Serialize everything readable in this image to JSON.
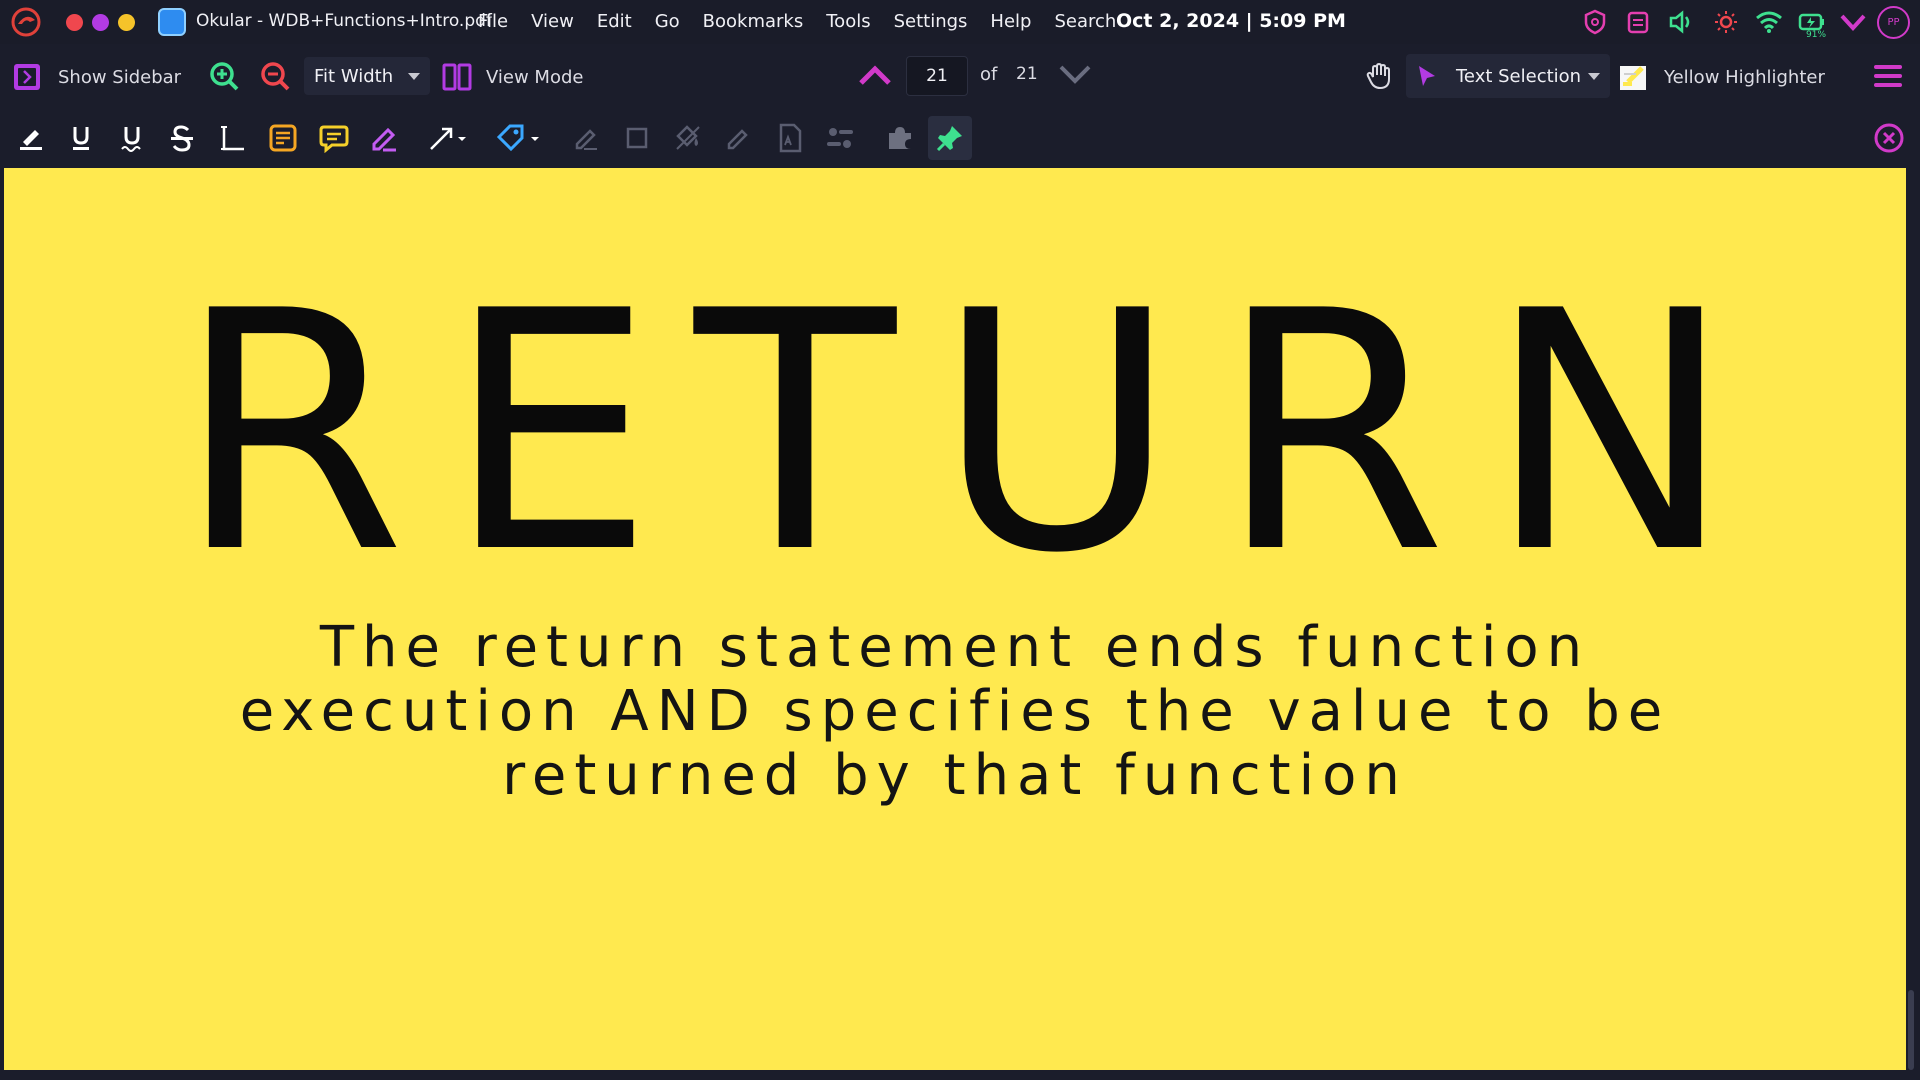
{
  "window": {
    "title": "Okular - WDB+Functions+Intro.pdf",
    "clock": "Oct 2, 2024 | 5:09 PM",
    "battery_percent": "91%",
    "avatar_initials": "PP"
  },
  "menu": {
    "items": [
      "File",
      "View",
      "Edit",
      "Go",
      "Bookmarks",
      "Tools",
      "Settings",
      "Help",
      "Search"
    ]
  },
  "toolbar": {
    "show_sidebar": "Show Sidebar",
    "zoom_mode": "Fit Width",
    "view_mode": "View Mode",
    "current_page": "21",
    "of_label": "of",
    "total_pages": "21",
    "selection_tool": "Text Selection",
    "annotation_tool": "Yellow Highlighter"
  },
  "document": {
    "heading": "RETURN",
    "body_lines": [
      "The return statement ends function",
      "execution AND specifies the value to be",
      "returned by that function"
    ],
    "background": "#ffe94f"
  },
  "colors": {
    "accent_magenta": "#d13ac9",
    "accent_green": "#3ee08f",
    "toolbar_bg": "#1b1d2b"
  }
}
